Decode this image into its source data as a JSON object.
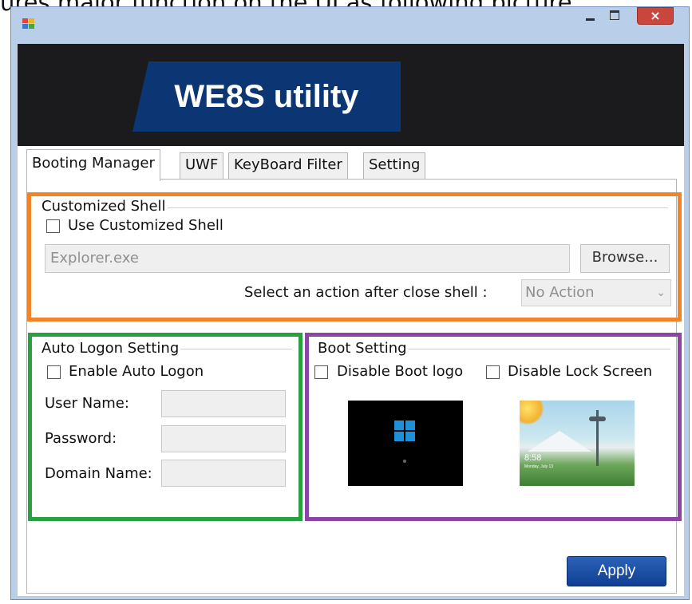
{
  "caption": "ures major function on the UI as following picture",
  "window": {
    "icon": "app-window-icon",
    "minimize_icon": "minimize-icon",
    "maximize_icon": "maximize-icon",
    "close_glyph": "×",
    "close_icon": "close-icon"
  },
  "banner": {
    "title": "WE8S utility",
    "accent": "#0b3673"
  },
  "tabs": [
    {
      "label": "Booting Manager",
      "active": true
    },
    {
      "label": "UWF",
      "active": false
    },
    {
      "label": "KeyBoard Filter",
      "active": false
    },
    {
      "label": "Setting",
      "active": false
    }
  ],
  "customized_shell": {
    "title": "Customized Shell",
    "checkbox_label": "Use Customized Shell",
    "checked": false,
    "shell_value": "Explorer.exe",
    "browse_label": "Browse...",
    "action_label": "Select an action after close shell :",
    "action_value": "No Action",
    "highlight_color": "#f0842a"
  },
  "auto_logon": {
    "title": "Auto Logon Setting",
    "checkbox_label": "Enable Auto Logon",
    "checked": false,
    "fields": [
      {
        "label": "User Name:",
        "value": ""
      },
      {
        "label": "Password:",
        "value": ""
      },
      {
        "label": "Domain Name:",
        "value": ""
      }
    ],
    "highlight_color": "#2aa140"
  },
  "boot_setting": {
    "title": "Boot Setting",
    "disable_boot_logo_label": "Disable Boot logo",
    "disable_lock_screen_label": "Disable Lock Screen",
    "boot_logo_checked": false,
    "lock_screen_checked": false,
    "boot_image_icon": "windows-logo-icon",
    "lock_image_time": "8:58",
    "lock_image_date": "Monday, July 13",
    "highlight_color": "#8a45a6"
  },
  "apply_label": "Apply"
}
